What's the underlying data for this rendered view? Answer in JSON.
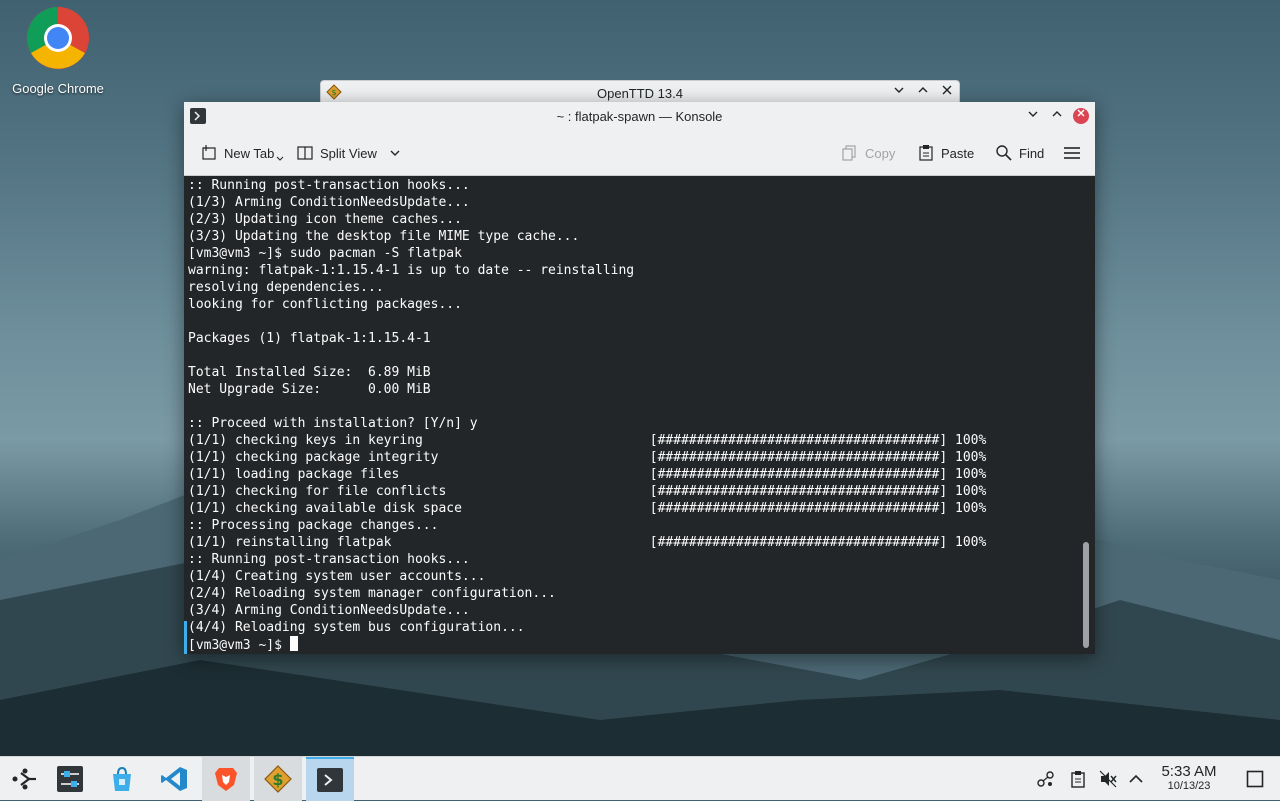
{
  "desktop": {
    "icons": [
      {
        "label": "Google Chrome",
        "icon": "chrome-icon"
      }
    ]
  },
  "background_window": {
    "title": "OpenTTD 13.4"
  },
  "konsole": {
    "title": "~ : flatpak-spawn — Konsole",
    "toolbar": {
      "new_tab": "New Tab",
      "split_view": "Split View",
      "copy": "Copy",
      "paste": "Paste",
      "find": "Find"
    },
    "terminal_lines": [
      ":: Running post-transaction hooks...",
      "(1/3) Arming ConditionNeedsUpdate...",
      "(2/3) Updating icon theme caches...",
      "(3/3) Updating the desktop file MIME type cache...",
      "[vm3@vm3 ~]$ sudo pacman -S flatpak",
      "warning: flatpak-1:1.15.4-1 is up to date -- reinstalling",
      "resolving dependencies...",
      "looking for conflicting packages...",
      "",
      "Packages (1) flatpak-1:1.15.4-1",
      "",
      "Total Installed Size:  6.89 MiB",
      "Net Upgrade Size:      0.00 MiB",
      "",
      ":: Proceed with installation? [Y/n] y",
      "(1/1) checking keys in keyring                             [####################################] 100%",
      "(1/1) checking package integrity                           [####################################] 100%",
      "(1/1) loading package files                                [####################################] 100%",
      "(1/1) checking for file conflicts                          [####################################] 100%",
      "(1/1) checking available disk space                        [####################################] 100%",
      ":: Processing package changes...",
      "(1/1) reinstalling flatpak                                 [####################################] 100%",
      ":: Running post-transaction hooks...",
      "(1/4) Creating system user accounts...",
      "(2/4) Reloading system manager configuration...",
      "(3/4) Arming ConditionNeedsUpdate...",
      "(4/4) Reloading system bus configuration..."
    ],
    "prompt": "[vm3@vm3 ~]$ "
  },
  "taskbar": {
    "tasks": [
      "app-launcher-icon",
      "system-settings-icon",
      "discover-store-icon",
      "vscode-icon",
      "brave-icon",
      "openttd-icon",
      "konsole-icon"
    ],
    "tray": [
      "network-icon",
      "clipboard-icon",
      "volume-muted-icon",
      "tray-expand-icon"
    ],
    "time": "5:33 AM",
    "date": "10/13/23"
  },
  "colors": {
    "accent": "#3daee9",
    "close": "#da4453",
    "terminal_bg": "#232629"
  }
}
